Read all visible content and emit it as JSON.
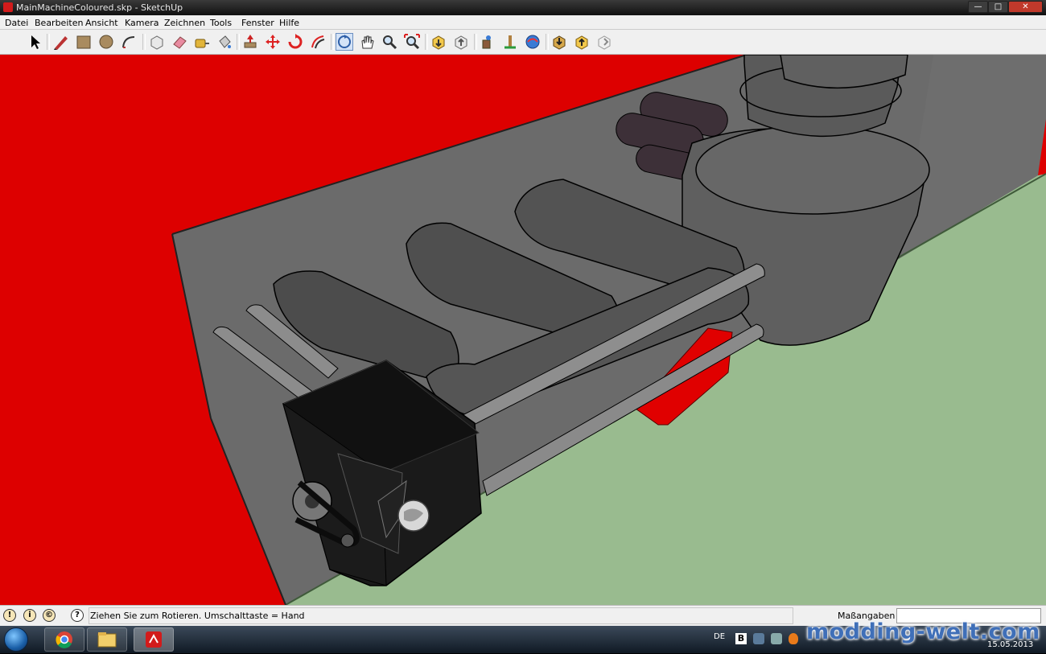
{
  "window": {
    "title": "MainMachineColoured.skp - SketchUp",
    "minimize_glyph": "—",
    "maximize_glyph": "□",
    "close_glyph": "✕"
  },
  "menu": {
    "items": [
      "Datei",
      "Bearbeiten",
      "Ansicht",
      "Kamera",
      "Zeichnen",
      "Tools",
      "Fenster",
      "Hilfe"
    ]
  },
  "toolbar": {
    "tools": [
      "select-icon",
      "pencil-icon",
      "rectangle-icon",
      "circle-icon",
      "arc-icon",
      "make-component-icon",
      "eraser-icon",
      "tape-measure-icon",
      "paint-bucket-icon",
      "push-pull-icon",
      "move-icon",
      "rotate-icon",
      "offset-icon",
      "orbit-icon",
      "pan-icon",
      "zoom-icon",
      "zoom-extents-icon",
      "get-models-icon",
      "share-model-icon",
      "share-component-icon",
      "dimension-icon",
      "follow-me-icon",
      "geo-location-icon",
      "protractor-icon",
      "axes-icon"
    ]
  },
  "status": {
    "hint": "Ziehen Sie zum Rotieren.  Umschalttaste = Hand",
    "measurements_label": "Maßangaben",
    "measurements_value": ""
  },
  "taskbar": {
    "lang": "DE",
    "date": "15.05.2013"
  },
  "watermark": {
    "text": "modding-welt.com"
  },
  "colors": {
    "wall": "#dd0000",
    "floor": "#99bb8f",
    "floor_edge": "#3f5a3a",
    "back_face": "#6b6b6b",
    "cylinder": "#5a5a5a",
    "block": "#151515",
    "rod": "#8c8c8c"
  }
}
